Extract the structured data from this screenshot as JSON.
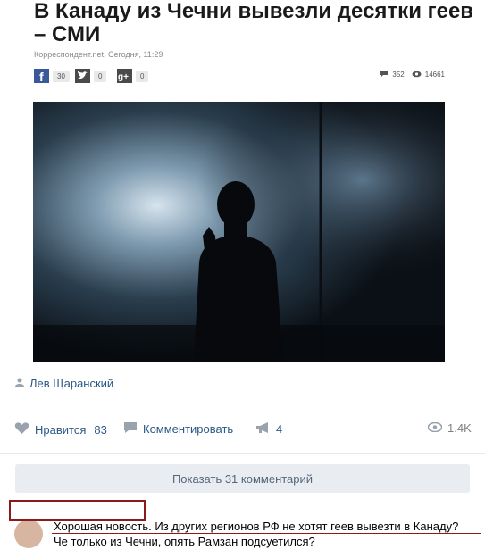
{
  "article": {
    "title": "В Канаду из Чечни вывезли десятки геев – СМИ",
    "meta": "Корреспондент.net, Сегодня, 11:29",
    "share": [
      {
        "icon": "facebook-icon",
        "count": "30"
      },
      {
        "icon": "twitter-icon",
        "count": "0"
      },
      {
        "icon": "google-plus-icon",
        "count": "0"
      }
    ],
    "comments_count": "352",
    "views_count": "14661"
  },
  "post": {
    "author": "Лев Щаранский",
    "like_label": "Нравится",
    "like_count": "83",
    "comment_label": "Комментировать",
    "repost_count": "4",
    "views": "1.4K",
    "show_comments": "Показать 31 комментарий"
  },
  "comment": {
    "line1": "Хорошая новость. Из других регионов РФ не хотят геев вывезти в Канаду?",
    "line2": "Че только из Чечни, опять Рамзан подсуетился?"
  },
  "colors": {
    "link": "#2a5885",
    "annotation": "#8b1a1a",
    "button_bg": "#e9ecf0"
  }
}
